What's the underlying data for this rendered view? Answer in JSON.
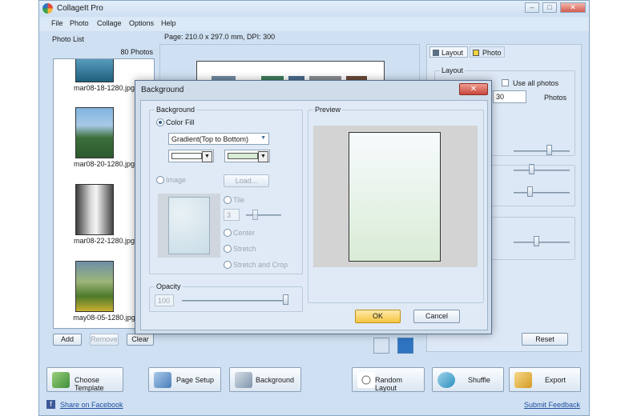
{
  "app": {
    "title": "CollageIt Pro"
  },
  "menu": [
    "File",
    "Photo",
    "Collage",
    "Options",
    "Help"
  ],
  "page_info": "Page: 210.0 x 297.0 mm, DPI: 300",
  "photo_list": {
    "title": "Photo List",
    "count": "80 Photos",
    "items": [
      "mar08-18-1280.jpg",
      "mar08-20-1280.jpg",
      "mar08-22-1280.jpg",
      "may08-05-1280.jpg"
    ],
    "add": "Add",
    "remove": "Remove",
    "clear": "Clear"
  },
  "right_panel": {
    "tab_layout": "Layout",
    "tab_photo": "Photo",
    "layout_group": "Layout",
    "use_all_photos": "Use all photos",
    "photo_count_value": "30",
    "photos_label": "Photos",
    "reset": "Reset"
  },
  "toolbar": {
    "choose_template": "Choose Template",
    "page_setup": "Page Setup",
    "background": "Background",
    "random_layout": "Random Layout",
    "shuffle": "Shuffle",
    "export": "Export"
  },
  "footer": {
    "share": "Share on Facebook",
    "feedback": "Submit Feedback"
  },
  "dialog": {
    "title": "Background",
    "background_group": "Background",
    "color_fill": "Color Fill",
    "gradient_option": "Gradient(Top to Bottom)",
    "color1": "#f7fbfe",
    "color2": "#d9ecd6",
    "image_label": "Image",
    "load": "Load...",
    "tile": "Tile",
    "tile_value": "3",
    "center": "Center",
    "stretch": "Stretch",
    "stretch_crop": "Stretch and Crop",
    "opacity_group": "Opacity",
    "opacity_value": "100",
    "opacity_level_percent": 100,
    "preview_group": "Preview",
    "ok": "OK",
    "cancel": "Cancel"
  },
  "colors": {
    "accent": "#f5c542",
    "window_bg": "#cfe0f2",
    "dialog_close": "#c8483c"
  }
}
